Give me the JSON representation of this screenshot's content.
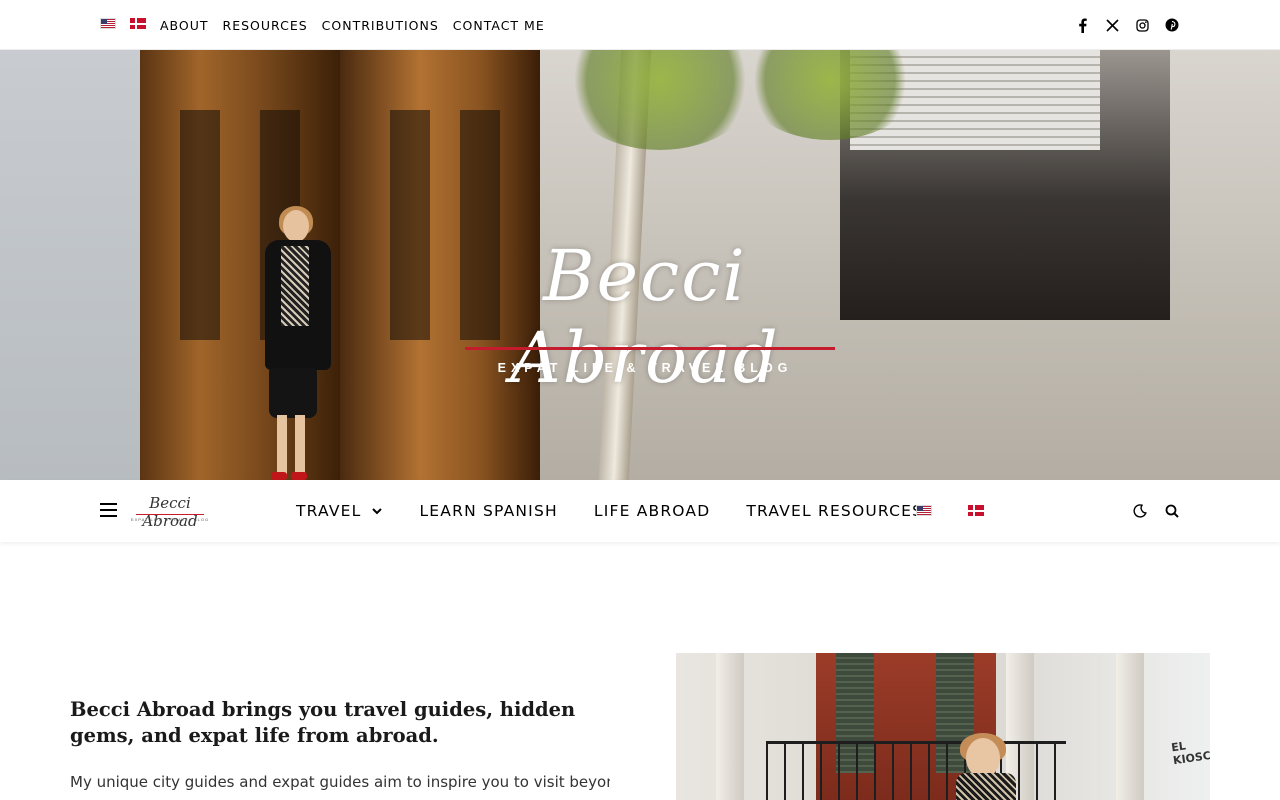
{
  "topbar": {
    "flags": [
      "English",
      "Danish"
    ],
    "nav": [
      "ABOUT",
      "RESOURCES",
      "CONTRIBUTIONS",
      "CONTACT ME"
    ],
    "social": [
      "facebook-icon",
      "x-icon",
      "instagram-icon",
      "pinterest-icon"
    ]
  },
  "hero": {
    "logo_script": "Becci Abroad",
    "logo_tagline": "EXPAT LIFE & TRAVEL BLOG",
    "accent_color": "#c41c2c"
  },
  "mainnav": {
    "logo_script": "Becci Abroad",
    "logo_tagline": "EXPAT LIFE & TRAVEL BLOG",
    "items": [
      "TRAVEL",
      "LEARN SPANISH",
      "LIFE ABROAD",
      "TRAVEL RESOURCES"
    ],
    "icons": [
      "menu-icon",
      "chevron-down-icon",
      "dark-mode-icon",
      "search-icon"
    ]
  },
  "content": {
    "intro_title": "Becci Abroad brings you travel guides, hidden gems, and expat life from abroad.",
    "intro_text": "My unique city guides and expat guides aim to inspire you to visit beyond a",
    "graffiti": "EL KIOSCO"
  }
}
